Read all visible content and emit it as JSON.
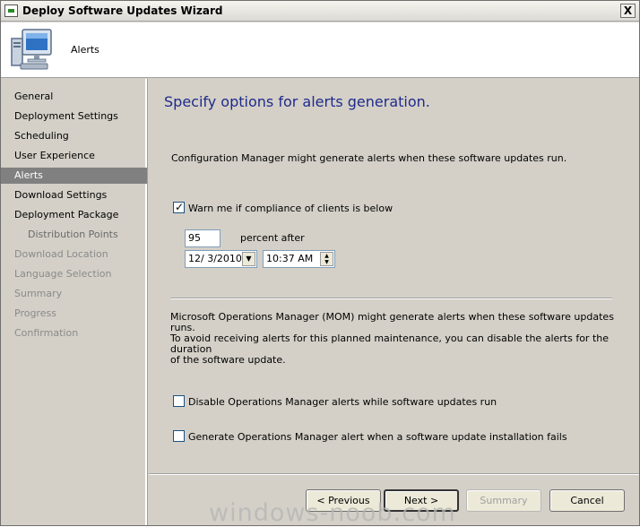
{
  "window": {
    "title": "Deploy Software Updates Wizard",
    "close_glyph": "X",
    "app_icon": "wizard-app-icon"
  },
  "header": {
    "title": "Alerts",
    "icon": "computer-icon"
  },
  "sidebar": {
    "items": [
      {
        "label": "General",
        "state": "normal"
      },
      {
        "label": "Deployment Settings",
        "state": "normal"
      },
      {
        "label": "Scheduling",
        "state": "normal"
      },
      {
        "label": "User Experience",
        "state": "normal"
      },
      {
        "label": "Alerts",
        "state": "active"
      },
      {
        "label": "Download Settings",
        "state": "normal"
      },
      {
        "label": "Deployment Package",
        "state": "normal"
      },
      {
        "label": "Distribution Points",
        "state": "sub"
      },
      {
        "label": "Download Location",
        "state": "disabled"
      },
      {
        "label": "Language Selection",
        "state": "disabled"
      },
      {
        "label": "Summary",
        "state": "disabled"
      },
      {
        "label": "Progress",
        "state": "disabled"
      },
      {
        "label": "Confirmation",
        "state": "disabled"
      }
    ]
  },
  "main": {
    "heading": "Specify options for alerts generation.",
    "intro": "Configuration Manager might generate alerts when these software updates run.",
    "warn_checkbox": {
      "label": "Warn me if compliance of clients is below",
      "checked": true
    },
    "percent_value": "95",
    "percent_after_label": "percent after",
    "date_value": "12/  3/2010",
    "time_value": "10:37 AM",
    "mom_text_line1": "Microsoft Operations Manager (MOM) might generate alerts when these software updates runs.",
    "mom_text_line2": "To avoid receiving alerts for this planned maintenance, you can disable the alerts for the duration",
    "mom_text_line3": "of the software update.",
    "disable_checkbox": {
      "label": "Disable Operations Manager alerts while software updates run",
      "checked": false
    },
    "generate_checkbox": {
      "label": "Generate Operations Manager alert when a software update installation fails",
      "checked": false
    }
  },
  "buttons": {
    "previous": "< Previous",
    "next": "Next >",
    "summary": "Summary",
    "cancel": "Cancel"
  },
  "watermark": "windows-noob.com",
  "colors": {
    "dialog_bg": "#d4d0c8",
    "heading": "#1f2a8a",
    "active_item_bg": "#808080"
  }
}
